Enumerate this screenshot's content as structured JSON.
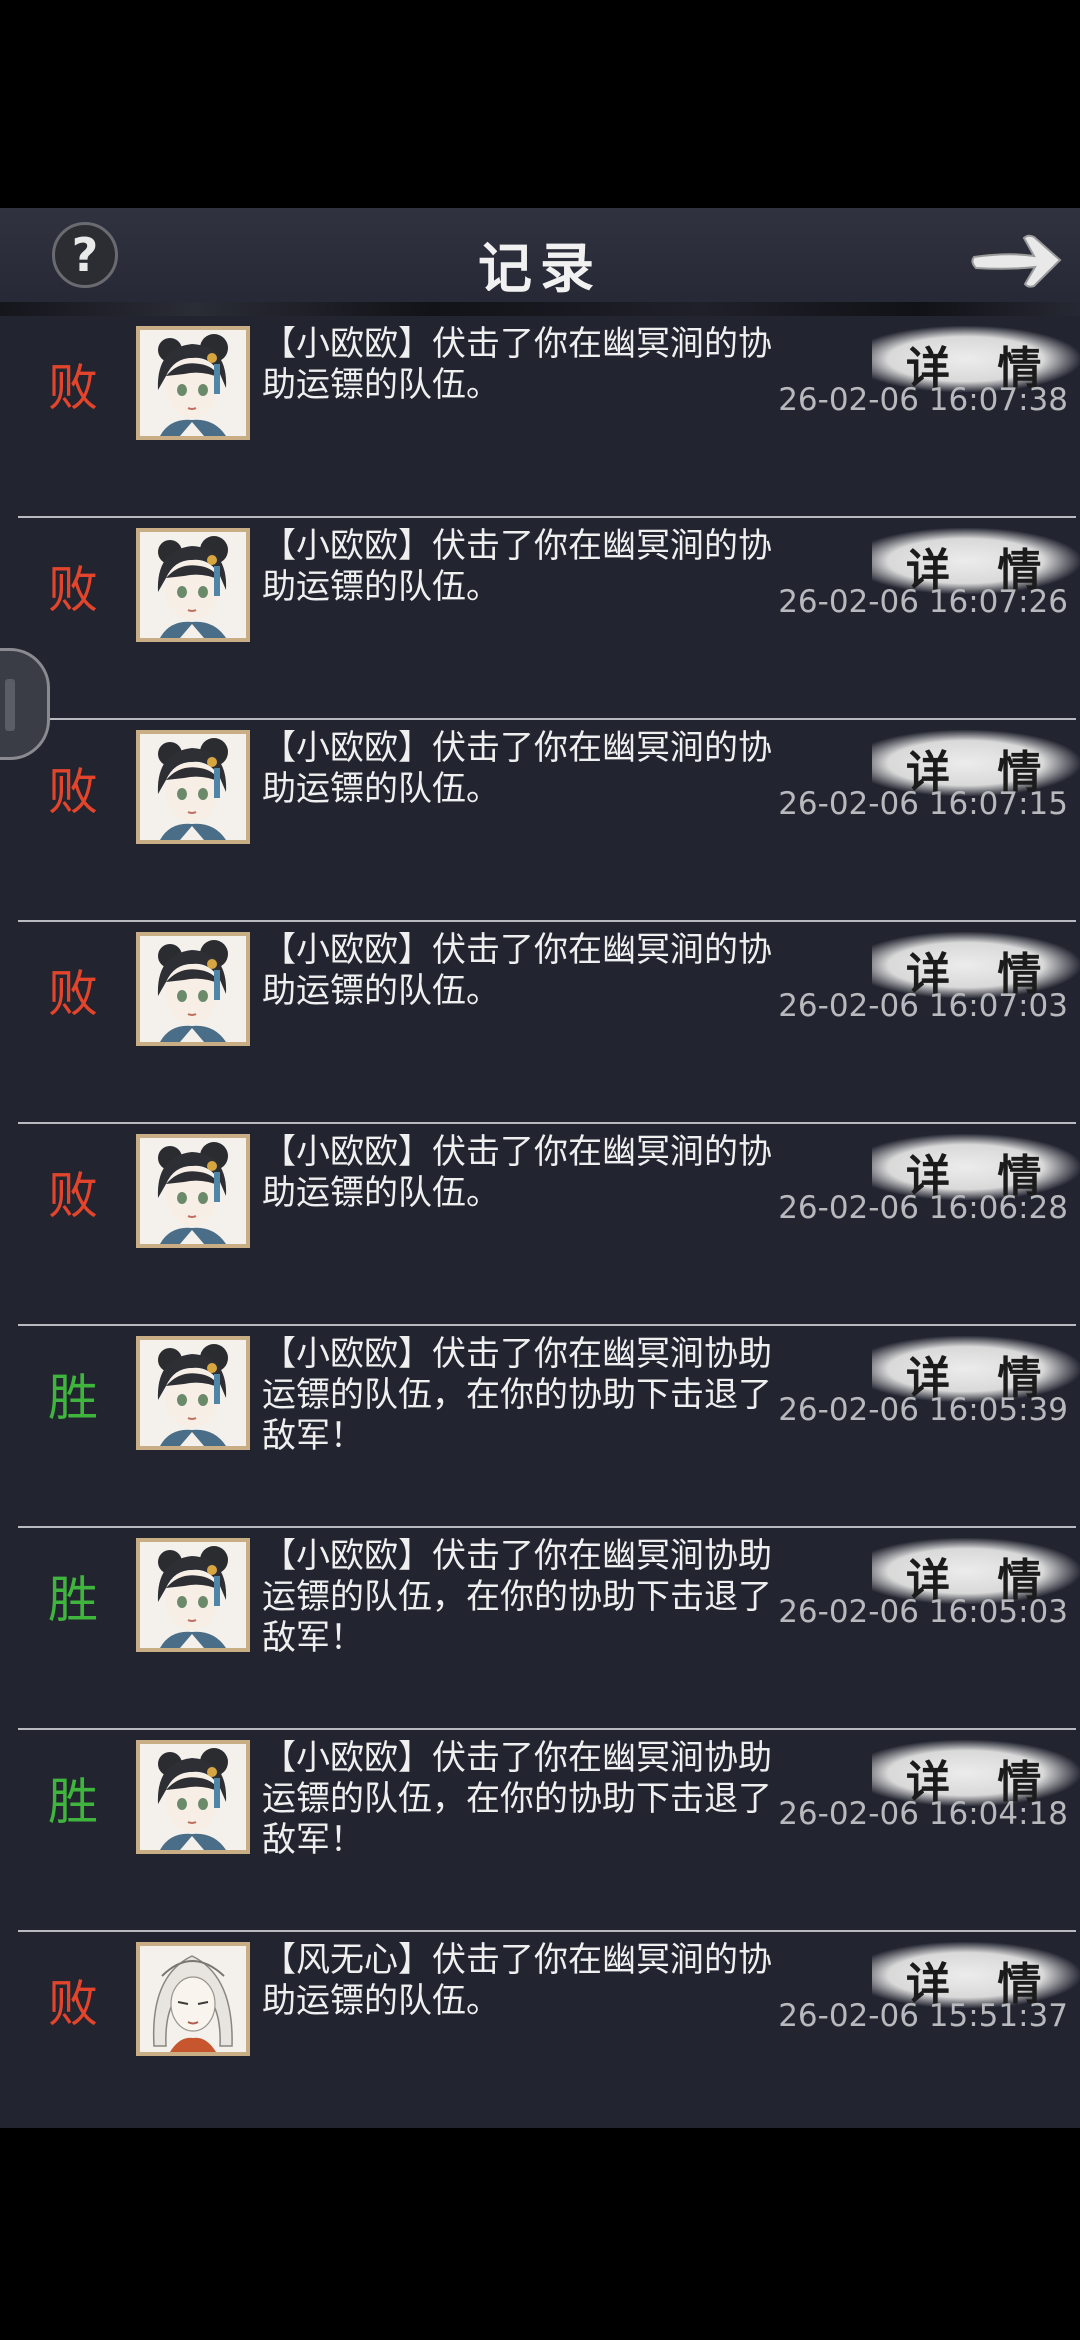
{
  "header": {
    "title": "记录",
    "help_icon": "question-icon",
    "back_icon": "arrow-right-icon"
  },
  "detail_label": "详 情",
  "records": [
    {
      "result": "败",
      "outcome": "lose",
      "avatar": "girl-avatar",
      "message": "【小欧欧】伏击了你在幽冥涧的协助运镖的队伍。",
      "time": "26-02-06 16:07:38"
    },
    {
      "result": "败",
      "outcome": "lose",
      "avatar": "girl-avatar",
      "message": "【小欧欧】伏击了你在幽冥涧的协助运镖的队伍。",
      "time": "26-02-06 16:07:26"
    },
    {
      "result": "败",
      "outcome": "lose",
      "avatar": "girl-avatar",
      "message": "【小欧欧】伏击了你在幽冥涧的协助运镖的队伍。",
      "time": "26-02-06 16:07:15"
    },
    {
      "result": "败",
      "outcome": "lose",
      "avatar": "girl-avatar",
      "message": "【小欧欧】伏击了你在幽冥涧的协助运镖的队伍。",
      "time": "26-02-06 16:07:03"
    },
    {
      "result": "败",
      "outcome": "lose",
      "avatar": "girl-avatar",
      "message": "【小欧欧】伏击了你在幽冥涧的协助运镖的队伍。",
      "time": "26-02-06 16:06:28"
    },
    {
      "result": "胜",
      "outcome": "win",
      "avatar": "girl-avatar",
      "message": "【小欧欧】伏击了你在幽冥涧协助运镖的队伍，在你的协助下击退了敌军！",
      "time": "26-02-06 16:05:39"
    },
    {
      "result": "胜",
      "outcome": "win",
      "avatar": "girl-avatar",
      "message": "【小欧欧】伏击了你在幽冥涧协助运镖的队伍，在你的协助下击退了敌军！",
      "time": "26-02-06 16:05:03"
    },
    {
      "result": "胜",
      "outcome": "win",
      "avatar": "girl-avatar",
      "message": "【小欧欧】伏击了你在幽冥涧协助运镖的队伍，在你的协助下击退了敌军！",
      "time": "26-02-06 16:04:18"
    },
    {
      "result": "败",
      "outcome": "lose",
      "avatar": "white-hair-avatar",
      "message": "【风无心】伏击了你在幽冥涧的协助运镖的队伍。",
      "time": "26-02-06 15:51:37"
    }
  ],
  "colors": {
    "lose": "#e2452b",
    "win": "#3fb53d",
    "background": "#222430"
  }
}
